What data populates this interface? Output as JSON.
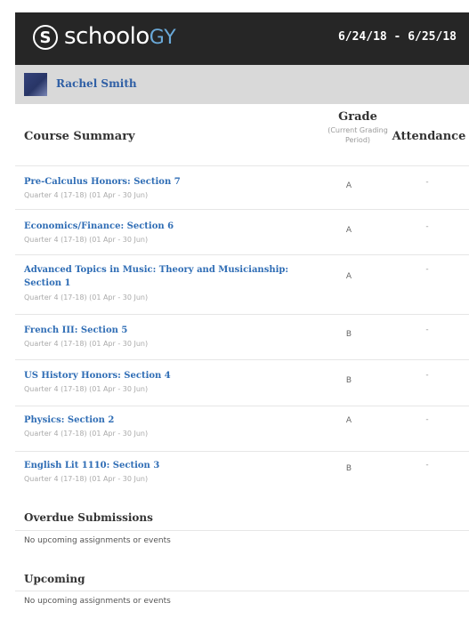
{
  "header": {
    "logo_letter": "S",
    "logo_text_main": "schoolo",
    "logo_text_accent": "GY",
    "date_range": "6/24/18 - 6/25/18"
  },
  "user": {
    "name": "Rachel Smith"
  },
  "table": {
    "title": "Course Summary",
    "grade_label": "Grade",
    "grade_sublabel": "(Current Grading Period)",
    "attendance_label": "Attendance",
    "courses": [
      {
        "name": "Pre-Calculus Honors: Section 7",
        "period": "Quarter 4 (17-18) (01 Apr - 30 Jun)",
        "grade": "A",
        "attendance": "-"
      },
      {
        "name": "Economics/Finance: Section 6",
        "period": "Quarter 4 (17-18) (01 Apr - 30 Jun)",
        "grade": "A",
        "attendance": "-"
      },
      {
        "name": "Advanced Topics in Music: Theory and Musicianship: Section 1",
        "period": "Quarter 4 (17-18) (01 Apr - 30 Jun)",
        "grade": "A",
        "attendance": "-"
      },
      {
        "name": "French III: Section 5",
        "period": "Quarter 4 (17-18) (01 Apr - 30 Jun)",
        "grade": "B",
        "attendance": "-"
      },
      {
        "name": "US History Honors: Section 4",
        "period": "Quarter 4 (17-18) (01 Apr - 30 Jun)",
        "grade": "B",
        "attendance": "-"
      },
      {
        "name": "Physics: Section 2",
        "period": "Quarter 4 (17-18) (01 Apr - 30 Jun)",
        "grade": "A",
        "attendance": "-"
      },
      {
        "name": "English Lit 1110: Section 3",
        "period": "Quarter 4 (17-18) (01 Apr - 30 Jun)",
        "grade": "B",
        "attendance": "-"
      }
    ]
  },
  "overdue": {
    "title": "Overdue Submissions",
    "text": "No upcoming assignments or events"
  },
  "upcoming": {
    "title": "Upcoming",
    "text": "No upcoming assignments or events"
  },
  "colors": {
    "header_bg": "#262626",
    "link": "#2f6db5",
    "user_bar_bg": "#d9d9d9"
  }
}
